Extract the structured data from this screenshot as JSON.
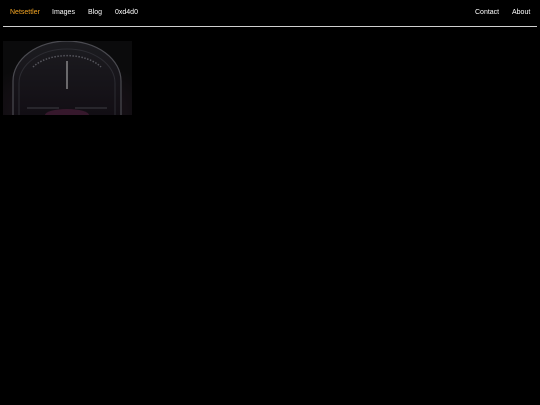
{
  "nav": {
    "brand": "Netsettler",
    "links": {
      "images": "Images",
      "blog": "Blog",
      "hex": "0xd4d0",
      "contact": "Contact",
      "about": "About"
    }
  },
  "colors": {
    "brand": "#f5a623",
    "background": "#000000",
    "text": "#ffffff",
    "divider": "#cfcfcf"
  },
  "gallery": {
    "thumbnail_icon": "gauge-dial-image"
  }
}
